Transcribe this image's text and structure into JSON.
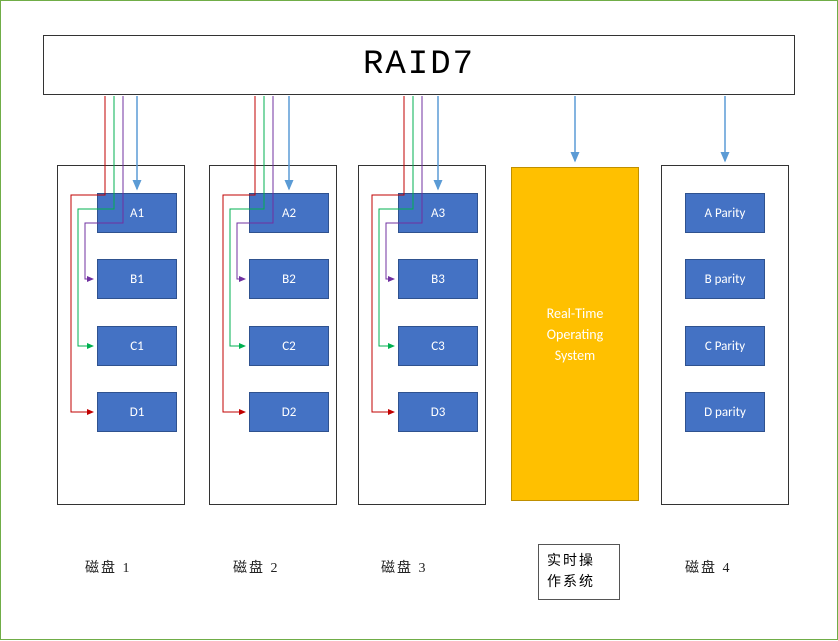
{
  "header": {
    "title": "RAID7"
  },
  "disks": [
    {
      "blocks": [
        "A1",
        "B1",
        "C1",
        "D1"
      ],
      "caption": "磁盘 1"
    },
    {
      "blocks": [
        "A2",
        "B2",
        "C2",
        "D2"
      ],
      "caption": "磁盘 2"
    },
    {
      "blocks": [
        "A3",
        "B3",
        "C3",
        "D3"
      ],
      "caption": "磁盘 3"
    },
    {
      "blocks": [
        "A Parity",
        "B parity",
        "C Parity",
        "D parity"
      ],
      "caption": "磁盘 4"
    }
  ],
  "rtos": {
    "label": "Real-Time\nOperating\nSystem",
    "caption": "实时操\n作系统"
  },
  "arrow_colors": {
    "red": "#c00000",
    "green": "#00b050",
    "purple": "#7030a0",
    "blue": "#5b9bd5"
  }
}
